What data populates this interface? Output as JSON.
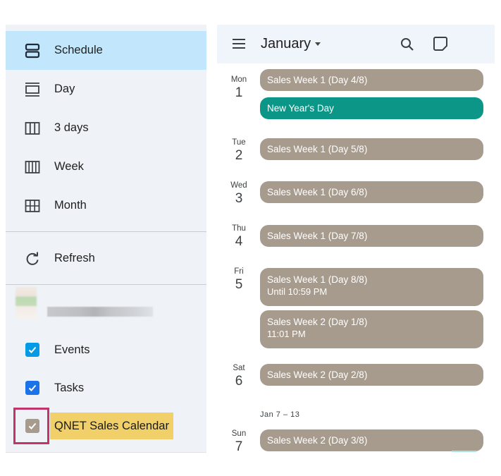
{
  "sidebar": {
    "views": [
      {
        "label": "Schedule",
        "icon": "schedule-view-icon",
        "active": true
      },
      {
        "label": "Day",
        "icon": "day-view-icon",
        "active": false
      },
      {
        "label": "3 days",
        "icon": "three-day-view-icon",
        "active": false
      },
      {
        "label": "Week",
        "icon": "week-view-icon",
        "active": false
      },
      {
        "label": "Month",
        "icon": "month-view-icon",
        "active": false
      }
    ],
    "refresh": {
      "label": "Refresh",
      "icon": "refresh-icon"
    },
    "calendars": [
      {
        "label": "Events",
        "checked": true,
        "color": "#039be5"
      },
      {
        "label": "Tasks",
        "checked": true,
        "color": "#1a73e8"
      },
      {
        "label": "QNET Sales Calendar",
        "checked": true,
        "color": "#a79b8e",
        "highlighted": true,
        "highlight_color": "#f1d06a",
        "outline_color": "#c0356b"
      }
    ],
    "account": {
      "name_blurred": true
    }
  },
  "header": {
    "month": "January",
    "menu_icon": "hamburger-menu-icon",
    "search_icon": "search-icon",
    "note_icon": "note-icon",
    "background": "#f0f4fb"
  },
  "schedule": {
    "colors": {
      "sales": "#a79b8e",
      "holiday": "#0b9688"
    },
    "days": [
      {
        "dow": "Mon",
        "date": "1",
        "events": [
          {
            "title": "Sales Week 1 (Day 4/8)",
            "sub": "",
            "type": "sales"
          },
          {
            "title": "New Year's Day",
            "sub": "",
            "type": "holiday"
          }
        ]
      },
      {
        "dow": "Tue",
        "date": "2",
        "events": [
          {
            "title": "Sales Week 1 (Day 5/8)",
            "sub": "",
            "type": "sales"
          }
        ]
      },
      {
        "dow": "Wed",
        "date": "3",
        "events": [
          {
            "title": "Sales Week 1 (Day 6/8)",
            "sub": "",
            "type": "sales"
          }
        ]
      },
      {
        "dow": "Thu",
        "date": "4",
        "events": [
          {
            "title": "Sales Week 1 (Day 7/8)",
            "sub": "",
            "type": "sales"
          }
        ]
      },
      {
        "dow": "Fri",
        "date": "5",
        "events": [
          {
            "title": "Sales Week 1 (Day 8/8)",
            "sub": "Until 10:59 PM",
            "type": "sales"
          },
          {
            "title": "Sales Week 2 (Day 1/8)",
            "sub": "11:01 PM",
            "type": "sales"
          }
        ]
      },
      {
        "dow": "Sat",
        "date": "6",
        "events": [
          {
            "title": "Sales Week 2 (Day 2/8)",
            "sub": "",
            "type": "sales"
          }
        ]
      },
      {
        "dow": "Sun",
        "date": "7",
        "events": [
          {
            "title": "Sales Week 2 (Day 3/8)",
            "sub": "",
            "type": "sales"
          }
        ]
      }
    ],
    "week_range_label": "Jan 7 – 13"
  }
}
